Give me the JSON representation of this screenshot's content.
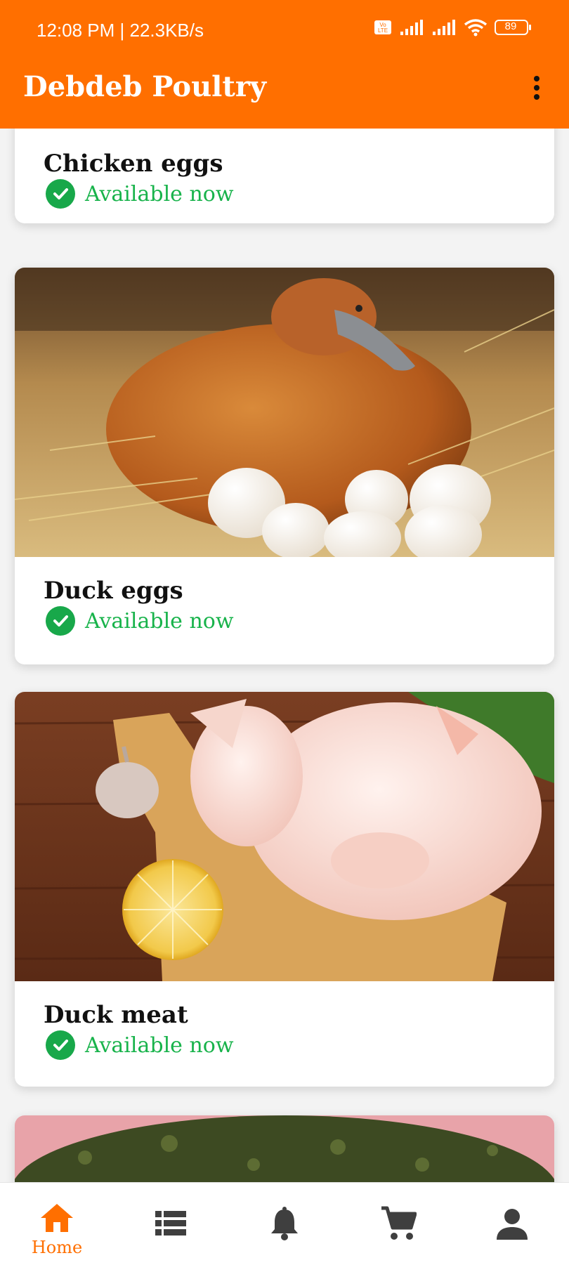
{
  "status_bar": {
    "time_speed": "12:08 PM | 22.3KB/s",
    "battery": "89"
  },
  "app": {
    "title": "Debdeb Poultry"
  },
  "cards": [
    {
      "name": "Chicken eggs",
      "status": "Available now"
    },
    {
      "name": "Duck eggs",
      "status": "Available now"
    },
    {
      "name": "Duck meat",
      "status": "Available now"
    }
  ],
  "nav": {
    "home_label": "Home",
    "active": "Home"
  },
  "colors": {
    "accent": "#ff6f00",
    "available": "#18b34b",
    "icon_inactive": "#3f3f3f"
  }
}
